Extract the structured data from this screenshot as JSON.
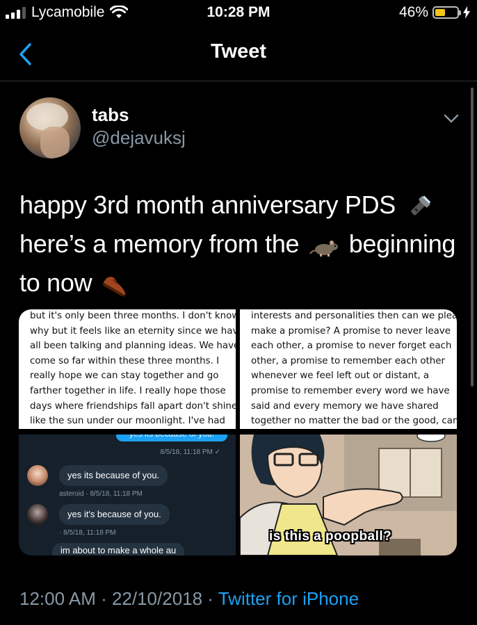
{
  "status_bar": {
    "carrier": "Lycamobile",
    "time": "10:28 PM",
    "battery_percent": "46%",
    "battery_level": 0.46,
    "signal_bars": 3
  },
  "nav": {
    "title": "Tweet"
  },
  "author": {
    "name": "tabs",
    "handle": "@dejavuksj"
  },
  "tweet": {
    "line1": "happy 3rd month anniversary PDS",
    "line2a": "here’s a memory from the",
    "line2b": "beginning",
    "line3": "to now",
    "emojis": [
      "flashlight-icon",
      "rat-icon",
      "shoe-icon"
    ]
  },
  "media": {
    "note_left": [
      "but it's only been three months. I don't know",
      "why but it feels like an eternity since we have",
      "all been talking and planning ideas. We have",
      "come so far within these three months. I",
      "really hope we can stay together and go",
      "farther together in life. I really hope those",
      "days where friendships fall apart don't shine",
      "like the sun under our moonlight. I've had"
    ],
    "note_right": [
      "interests and personalities then can we please",
      "make a promise? A promise to never leave",
      "each other, a promise to never forget each",
      "other, a promise to remember each other",
      "whenever we feel left out or distant, a",
      "promise to remember every word we have",
      "said and every memory we have shared",
      "together no matter the bad or the good, can"
    ],
    "chat": {
      "cut_off_top": "yes its because of you.",
      "sent_timestamp": "8/5/18, 11:18 PM ✓",
      "msg1": "yes its because of you.",
      "msg1_meta": "asteroid · 8/5/18, 11:18 PM",
      "msg2": "yes it's because of you.",
      "msg2_meta": "· 8/5/18, 11:18 PM",
      "msg3_partial": "im about to make a whole au"
    },
    "meme_caption": "is this a poopball?"
  },
  "footer": {
    "timestamp": "12:00 AM · 22/10/2018 ·",
    "source": "Twitter for iPhone"
  }
}
